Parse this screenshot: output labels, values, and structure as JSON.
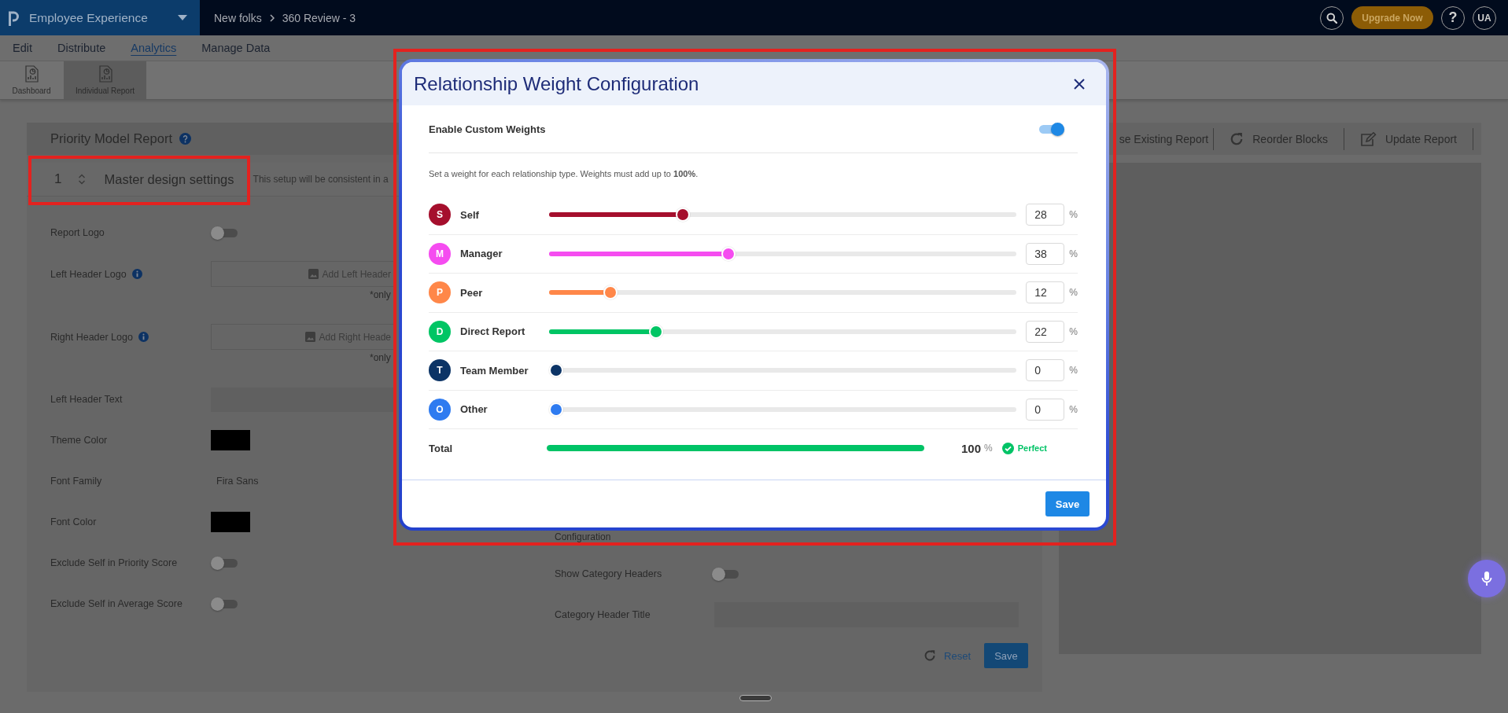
{
  "top_bar": {
    "app_name": "Employee Experience",
    "breadcrumb": [
      {
        "label": "New folks"
      },
      {
        "label": "360 Review - 3"
      }
    ],
    "upgrade_button": "Upgrade Now",
    "help_button": "?",
    "user_initials": "UA"
  },
  "menu": [
    {
      "label": "Edit",
      "selected": false
    },
    {
      "label": "Distribute",
      "selected": false
    },
    {
      "label": "Analytics",
      "selected": true
    },
    {
      "label": "Manage Data",
      "selected": false
    }
  ],
  "toolbar": [
    {
      "label": "Dashboard",
      "selected": false
    },
    {
      "label": "Individual Report",
      "selected": true
    }
  ],
  "report_panel": {
    "title": "Priority Model Report",
    "section": {
      "number": "1",
      "title": "Master design settings",
      "description": "This setup will be consistent in a",
      "highlighted": true
    },
    "settings": [
      {
        "kind": "toggle",
        "label": "Report Logo",
        "info": false,
        "on": false
      },
      {
        "kind": "upload",
        "label": "Left Header Logo",
        "info": true,
        "button": "Add Left Header",
        "note": "*only"
      },
      {
        "kind": "upload",
        "label": "Right Header Logo",
        "info": true,
        "button": "Add Right Heade",
        "note": "*only"
      },
      {
        "kind": "input",
        "label": "Left Header Text",
        "info": false
      },
      {
        "kind": "color",
        "label": "Theme Color",
        "info": false,
        "color": "#000000"
      },
      {
        "kind": "value",
        "label": "Font Family",
        "info": false,
        "value": "Fira Sans"
      },
      {
        "kind": "color",
        "label": "Font Color",
        "info": false,
        "color": "#000000"
      },
      {
        "kind": "toggle",
        "label": "Exclude Self in Priority Score",
        "info": false,
        "on": false
      },
      {
        "kind": "toggle",
        "label": "Exclude Self in Average Score",
        "info": false,
        "on": false
      }
    ],
    "more_settings": [
      {
        "kind": "label",
        "label": "Configuration",
        "info": false
      },
      {
        "kind": "toggle",
        "label": "Show Category Headers",
        "info": false,
        "on": false
      },
      {
        "kind": "input",
        "label": "Category Header Title",
        "info": false
      }
    ],
    "reset_button": "Reset",
    "save_button": "Save"
  },
  "preview_panel": {
    "actions": [
      {
        "kind": "plain",
        "label": "se Existing Report"
      },
      {
        "kind": "reorder",
        "label": "Reorder Blocks"
      },
      {
        "kind": "edit",
        "label": "Update Report"
      }
    ]
  },
  "modal": {
    "title": "Relationship Weight Configuration",
    "highlighted": true,
    "enable": {
      "label": "Enable Custom Weights",
      "on": true
    },
    "hint": "Set a weight for each relationship type. Weights must add up to **100%**.",
    "weights": [
      {
        "initial": "S",
        "name": "Self",
        "color": "#a50f2d",
        "level": 0.28,
        "value": "28",
        "unit": "%"
      },
      {
        "initial": "M",
        "name": "Manager",
        "color": "#f54cf0",
        "level": 0.38,
        "value": "38",
        "unit": "%"
      },
      {
        "initial": "P",
        "name": "Peer",
        "color": "#ff8749",
        "level": 0.12,
        "value": "12",
        "unit": "%"
      },
      {
        "initial": "D",
        "name": "Direct Report",
        "color": "#00c564",
        "level": 0.22,
        "value": "22",
        "unit": "%"
      },
      {
        "initial": "T",
        "name": "Team Member",
        "color": "#0c3466",
        "level": 0,
        "value": "0",
        "unit": "%"
      },
      {
        "initial": "O",
        "name": "Other",
        "color": "#2e7bf0",
        "level": 0,
        "value": "0",
        "unit": "%"
      }
    ],
    "total": {
      "label": "Total",
      "level": 1,
      "value": "100",
      "unit": "%",
      "status": "Perfect"
    },
    "save_button": "Save"
  }
}
